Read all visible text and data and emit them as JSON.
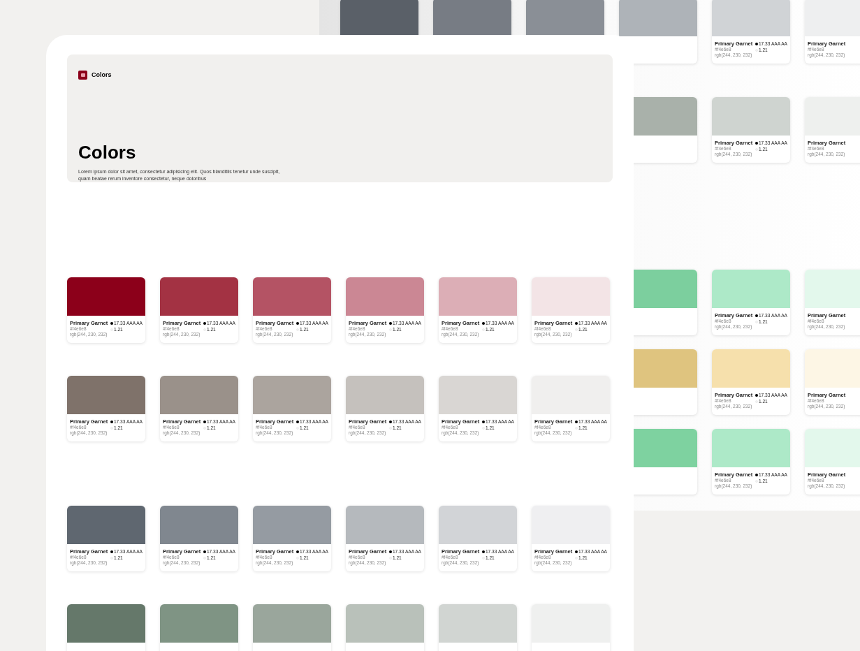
{
  "background_page": {
    "rows": [
      {
        "cards": [
          {
            "color": "#5a6068"
          },
          {
            "color": "#777c84"
          },
          {
            "color": "#8a8f96"
          },
          {
            "color": "#aeb3b8"
          },
          {
            "color": "#d0d3d6",
            "name": "Primary Garnet",
            "hex": "#f4e6e8",
            "rgb": "rgb(244, 230, 232)",
            "contrast": "17.33 AAA AA",
            "ratio": "1.21"
          },
          {
            "color": "#eeeff0",
            "name": "Primary Garnet",
            "hex": "#f4e6e8",
            "rgb": "rgb(244, 230, 232)"
          }
        ]
      },
      {
        "cards": [
          {
            "color": "#a9b1aa"
          },
          {
            "color": "#cfd4d0",
            "name": "Primary Garnet",
            "hex": "#f4e6e8",
            "rgb": "rgb(244, 230, 232)",
            "contrast": "17.33 AAA AA",
            "ratio": "1.21"
          },
          {
            "color": "#eef0ee",
            "name": "Primary Garnet",
            "hex": "#f4e6e8",
            "rgb": "rgb(244, 230, 232)"
          }
        ]
      },
      {
        "cards": [
          {
            "color": "#7ccf9e"
          },
          {
            "color": "#ade9c8",
            "name": "Primary Garnet",
            "hex": "#f4e6e8",
            "rgb": "rgb(244, 230, 232)",
            "contrast": "17.33 AAA AA",
            "ratio": "1.21"
          },
          {
            "color": "#e3f8ec",
            "name": "Primary Garnet",
            "hex": "#f4e6e8",
            "rgb": "rgb(244, 230, 232)"
          }
        ]
      },
      {
        "cards": [
          {
            "color": "#dfc47f"
          },
          {
            "color": "#f6e0ac",
            "name": "Primary Garnet",
            "hex": "#f4e6e8",
            "rgb": "rgb(244, 230, 232)",
            "contrast": "17.33 AAA AA",
            "ratio": "1.21"
          },
          {
            "color": "#fdf6e5",
            "name": "Primary Garnet",
            "hex": "#f4e6e8",
            "rgb": "rgb(244, 230, 232)"
          }
        ]
      },
      {
        "cards": [
          {
            "color": "#7ed2a0"
          },
          {
            "color": "#ade9c8",
            "name": "Primary Garnet",
            "hex": "#f4e6e8",
            "rgb": "rgb(244, 230, 232)",
            "contrast": "17.33 AAA AA",
            "ratio": "1.21"
          },
          {
            "color": "#e3f8ec",
            "name": "Primary Garnet",
            "hex": "#f4e6e8",
            "rgb": "rgb(244, 230, 232)"
          }
        ]
      }
    ]
  },
  "page": {
    "brand": {
      "label": "Colors"
    },
    "hero": {
      "title": "Colors",
      "description": "Lorem ipsum dolor sit amet, consectetur adipisicing elit. Quos blanditiis tenetur unde suscipit, quam beatae rerum inventore consectetur, neque doloribus"
    },
    "palette_rows": [
      {
        "cards": [
          {
            "color": "#8c001a",
            "name": "Primary Garnet",
            "hex": "#f4e6e8",
            "rgb": "rgb(244, 230, 232)",
            "contrast": "17.33 AAA AA",
            "ratio": "1.21"
          },
          {
            "color": "#a33243",
            "name": "Primary Garnet",
            "hex": "#f4e6e8",
            "rgb": "rgb(244, 230, 232)",
            "contrast": "17.33 AAA AA",
            "ratio": "1.21"
          },
          {
            "color": "#b45364",
            "name": "Primary Garnet",
            "hex": "#f4e6e8",
            "rgb": "rgb(244, 230, 232)",
            "contrast": "17.33 AAA AA",
            "ratio": "1.21"
          },
          {
            "color": "#cb8794",
            "name": "Primary Garnet",
            "hex": "#f4e6e8",
            "rgb": "rgb(244, 230, 232)",
            "contrast": "17.33 AAA AA",
            "ratio": "1.21"
          },
          {
            "color": "#dcaeb6",
            "name": "Primary Garnet",
            "hex": "#f4e6e8",
            "rgb": "rgb(244, 230, 232)",
            "contrast": "17.33 AAA AA",
            "ratio": "1.21"
          },
          {
            "color": "#f3e4e6",
            "name": "Primary Garnet",
            "hex": "#f4e6e8",
            "rgb": "rgb(244, 230, 232)",
            "contrast": "17.33 AAA AA",
            "ratio": "1.21"
          }
        ]
      },
      {
        "cards": [
          {
            "color": "#7f726a",
            "name": "Primary Garnet",
            "hex": "#f4e6e8",
            "rgb": "rgb(244, 230, 232)",
            "contrast": "17.33 AAA AA",
            "ratio": "1.21"
          },
          {
            "color": "#9a918a",
            "name": "Primary Garnet",
            "hex": "#f4e6e8",
            "rgb": "rgb(244, 230, 232)",
            "contrast": "17.33 AAA AA",
            "ratio": "1.21"
          },
          {
            "color": "#aba49e",
            "name": "Primary Garnet",
            "hex": "#f4e6e8",
            "rgb": "rgb(244, 230, 232)",
            "contrast": "17.33 AAA AA",
            "ratio": "1.21"
          },
          {
            "color": "#c5c1bd",
            "name": "Primary Garnet",
            "hex": "#f4e6e8",
            "rgb": "rgb(244, 230, 232)",
            "contrast": "17.33 AAA AA",
            "ratio": "1.21"
          },
          {
            "color": "#d9d6d3",
            "name": "Primary Garnet",
            "hex": "#f4e6e8",
            "rgb": "rgb(244, 230, 232)",
            "contrast": "17.33 AAA AA",
            "ratio": "1.21"
          },
          {
            "color": "#f0efee",
            "name": "Primary Garnet",
            "hex": "#f4e6e8",
            "rgb": "rgb(244, 230, 232)",
            "contrast": "17.33 AAA AA",
            "ratio": "1.21"
          }
        ]
      },
      {
        "cards": [
          {
            "color": "#5f6770",
            "name": "Primary Garnet",
            "hex": "#f4e6e8",
            "rgb": "rgb(244, 230, 232)",
            "contrast": "17.33 AAA AA",
            "ratio": "1.21"
          },
          {
            "color": "#80878f",
            "name": "Primary Garnet",
            "hex": "#f4e6e8",
            "rgb": "rgb(244, 230, 232)",
            "contrast": "17.33 AAA AA",
            "ratio": "1.21"
          },
          {
            "color": "#959ba2",
            "name": "Primary Garnet",
            "hex": "#f4e6e8",
            "rgb": "rgb(244, 230, 232)",
            "contrast": "17.33 AAA AA",
            "ratio": "1.21"
          },
          {
            "color": "#b5b9bd",
            "name": "Primary Garnet",
            "hex": "#f4e6e8",
            "rgb": "rgb(244, 230, 232)",
            "contrast": "17.33 AAA AA",
            "ratio": "1.21"
          },
          {
            "color": "#d2d4d7",
            "name": "Primary Garnet",
            "hex": "#f4e6e8",
            "rgb": "rgb(244, 230, 232)",
            "contrast": "17.33 AAA AA",
            "ratio": "1.21"
          },
          {
            "color": "#efeff1",
            "name": "Primary Garnet",
            "hex": "#f4e6e8",
            "rgb": "rgb(244, 230, 232)",
            "contrast": "17.33 AAA AA",
            "ratio": "1.21"
          }
        ]
      },
      {
        "cards": [
          {
            "color": "#65786a"
          },
          {
            "color": "#7f9484"
          },
          {
            "color": "#9aa69c"
          },
          {
            "color": "#b9c1ba"
          },
          {
            "color": "#d1d5d2"
          },
          {
            "color": "#eff0ef"
          }
        ]
      }
    ]
  }
}
